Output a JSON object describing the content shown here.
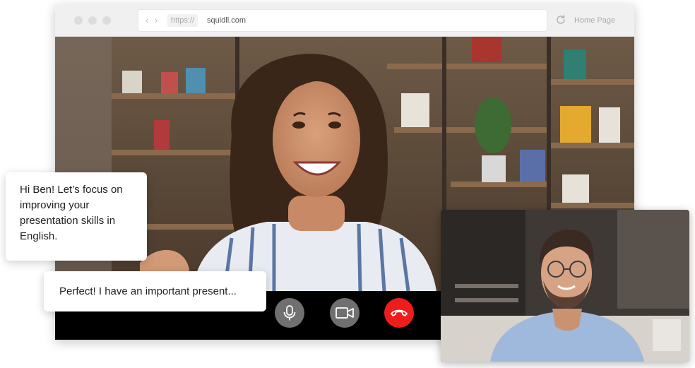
{
  "browser": {
    "url_protocol": "https://",
    "url_domain": "squidll.com",
    "home_label": "Home Page",
    "icons": [
      "window-dot",
      "back-arrow-icon",
      "forward-arrow-icon",
      "reload-icon"
    ]
  },
  "call": {
    "controls": [
      {
        "name": "microphone",
        "icon": "microphone-icon"
      },
      {
        "name": "camera",
        "icon": "video-camera-icon"
      },
      {
        "name": "end-call",
        "icon": "phone-hangup-icon",
        "color": "#ef1c1c"
      }
    ]
  },
  "chat": {
    "message_1": "Hi Ben! Let’s focus on improving your presentation skills in English.",
    "message_2": "Perfect! I have an important present..."
  },
  "colors": {
    "accent_red": "#ef1c1c",
    "control_gray": "#707070",
    "chrome_bg": "#f0f0f0"
  }
}
